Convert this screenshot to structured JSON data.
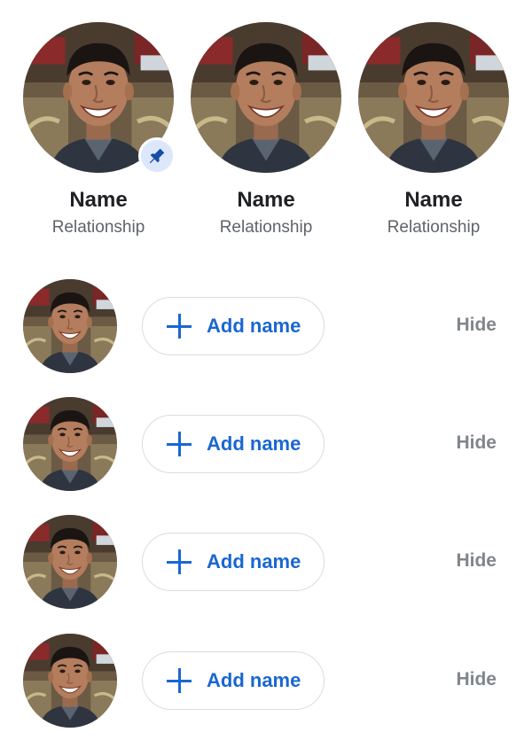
{
  "featured": [
    {
      "name": "Name",
      "relationship": "Relationship",
      "pinned": true
    },
    {
      "name": "Name",
      "relationship": "Relationship",
      "pinned": false
    },
    {
      "name": "Name",
      "relationship": "Relationship",
      "pinned": false
    }
  ],
  "suggestions": [
    {
      "add_label": "Add name",
      "hide_label": "Hide"
    },
    {
      "add_label": "Add name",
      "hide_label": "Hide"
    },
    {
      "add_label": "Add name",
      "hide_label": "Hide"
    },
    {
      "add_label": "Add name",
      "hide_label": "Hide"
    }
  ],
  "icons": {
    "pin": "pin-icon",
    "add": "plus-icon"
  },
  "colors": {
    "accent": "#1967d2",
    "pin_badge_bg": "#dce7fb",
    "pin_icon": "#174ea6",
    "muted_text": "#80868b",
    "outline": "#dadce0"
  }
}
